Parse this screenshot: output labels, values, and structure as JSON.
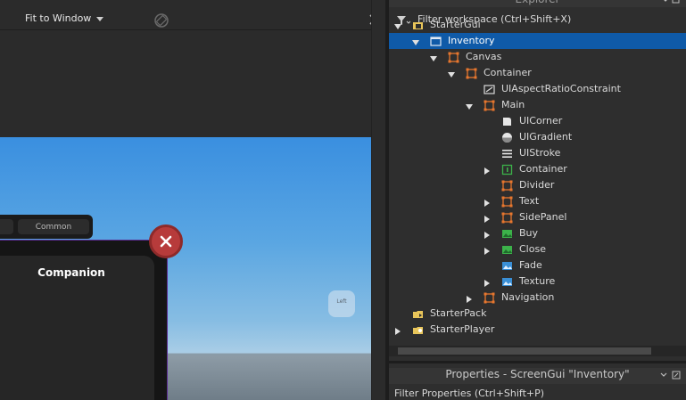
{
  "viewport": {
    "zoom_label": "Fit to Window",
    "tabs": [
      "Common"
    ],
    "panel_title": "Companion",
    "gizmo_label": "Left"
  },
  "explorer": {
    "title": "Explorer",
    "filter_placeholder": "Filter workspace (Ctrl+Shift+X)",
    "tree": [
      {
        "label": "StarterGui",
        "depth": 0,
        "expanded": true,
        "icon": "startergui-icon"
      },
      {
        "label": "Inventory",
        "depth": 1,
        "expanded": true,
        "icon": "screengui-icon",
        "selected": true
      },
      {
        "label": "Canvas",
        "depth": 2,
        "expanded": true,
        "icon": "frame-icon"
      },
      {
        "label": "Container",
        "depth": 3,
        "expanded": true,
        "icon": "frame-icon"
      },
      {
        "label": "UIAspectRatioConstraint",
        "depth": 4,
        "icon": "aspectratio-icon"
      },
      {
        "label": "Main",
        "depth": 4,
        "expanded": true,
        "icon": "frame-icon"
      },
      {
        "label": "UICorner",
        "depth": 5,
        "icon": "uicorner-icon"
      },
      {
        "label": "UIGradient",
        "depth": 5,
        "icon": "uigradient-icon"
      },
      {
        "label": "UIStroke",
        "depth": 5,
        "icon": "uistroke-icon"
      },
      {
        "label": "Container",
        "depth": 5,
        "collapsed": true,
        "icon": "scrollingframe-icon"
      },
      {
        "label": "Divider",
        "depth": 5,
        "icon": "frame-icon"
      },
      {
        "label": "Text",
        "depth": 5,
        "collapsed": true,
        "icon": "frame-icon"
      },
      {
        "label": "SidePanel",
        "depth": 5,
        "collapsed": true,
        "icon": "frame-icon"
      },
      {
        "label": "Buy",
        "depth": 5,
        "collapsed": true,
        "icon": "imagebutton-icon"
      },
      {
        "label": "Close",
        "depth": 5,
        "collapsed": true,
        "icon": "imagebutton-icon"
      },
      {
        "label": "Fade",
        "depth": 5,
        "icon": "imagelabel-icon"
      },
      {
        "label": "Texture",
        "depth": 5,
        "collapsed": true,
        "icon": "imagelabel-icon"
      },
      {
        "label": "Navigation",
        "depth": 4,
        "collapsed": true,
        "icon": "frame-icon"
      },
      {
        "label": "StarterPack",
        "depth": 0,
        "icon": "starterpack-icon"
      },
      {
        "label": "StarterPlayer",
        "depth": 0,
        "collapsed": true,
        "icon": "starterplayer-icon"
      }
    ]
  },
  "properties": {
    "title": "Properties - ScreenGui \"Inventory\"",
    "filter_placeholder": "Filter Properties (Ctrl+Shift+P)"
  },
  "colors": {
    "selection": "#0f5aa8",
    "frame_icon": "#e8772e",
    "accent_green": "#3cb24a",
    "close_red": "#b73b3b"
  }
}
